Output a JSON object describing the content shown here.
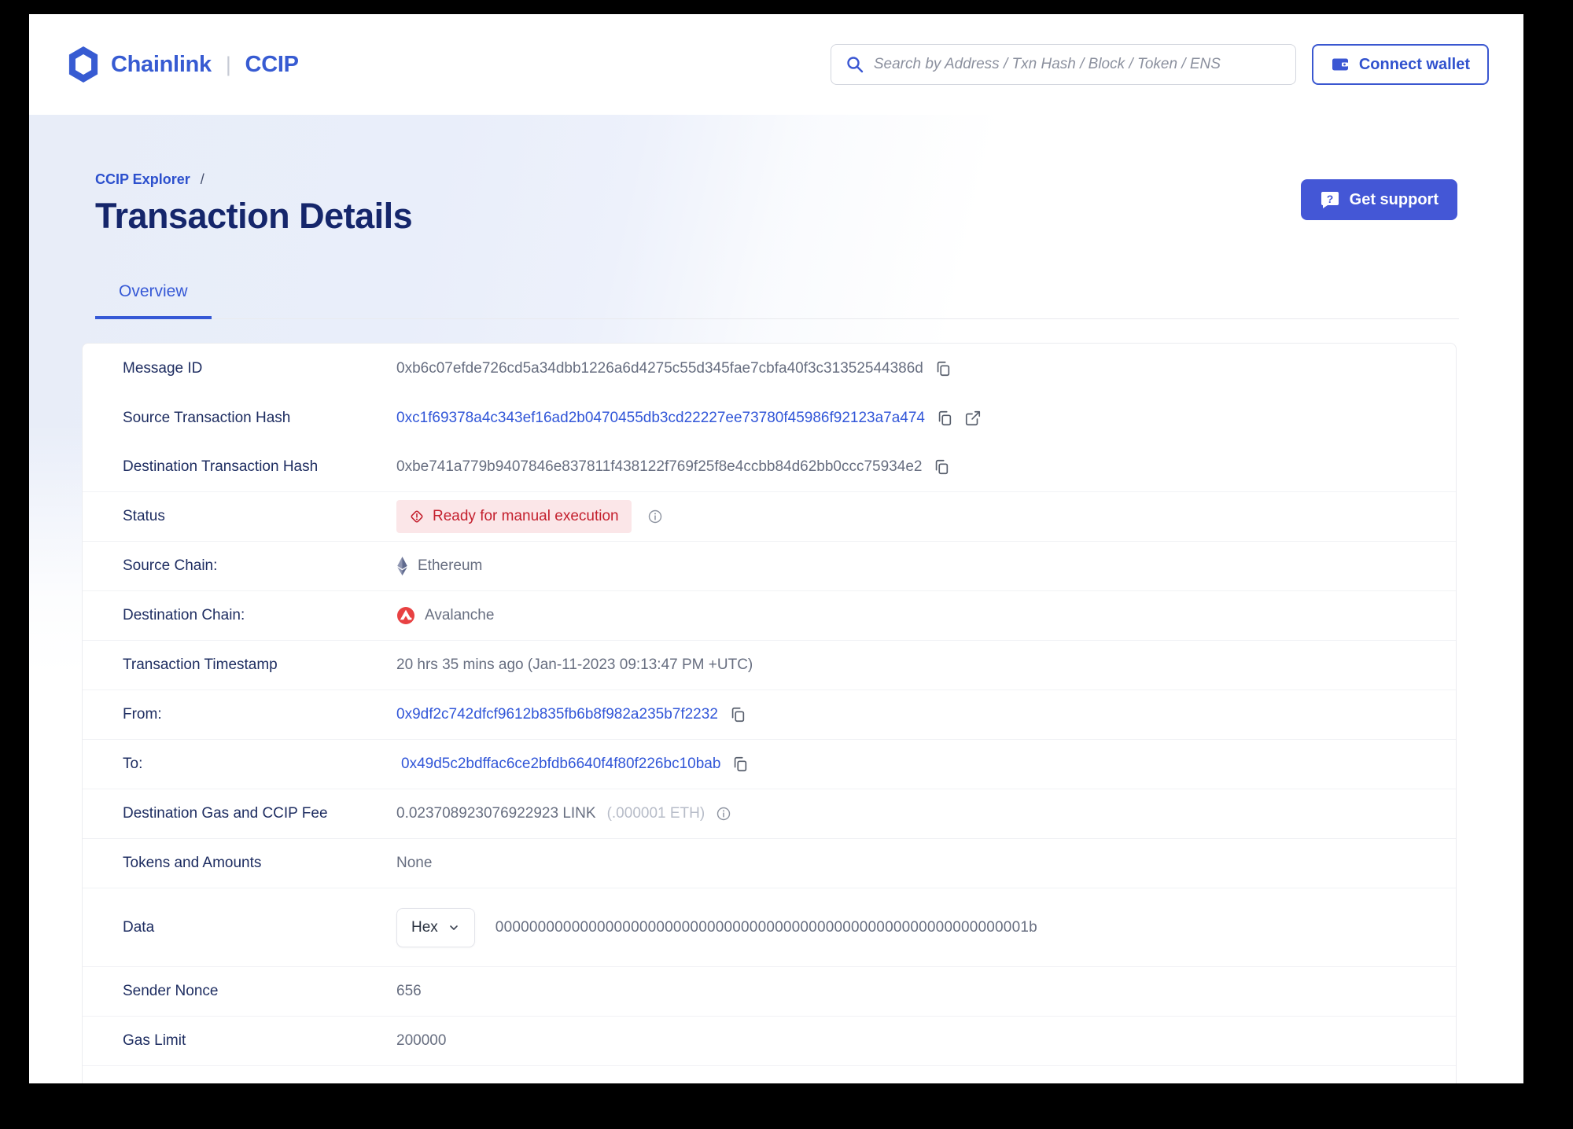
{
  "header": {
    "brand": "Chainlink",
    "brand_divider": "|",
    "product": "CCIP",
    "search_placeholder": "Search by Address / Txn Hash / Block / Token / ENS",
    "connect_wallet_label": "Connect wallet"
  },
  "hero": {
    "breadcrumb": "CCIP Explorer",
    "breadcrumb_separator": "/",
    "title": "Transaction Details",
    "get_support_label": "Get support"
  },
  "tabs": {
    "overview_label": "Overview"
  },
  "details": {
    "message_id": {
      "label": "Message ID",
      "value": "0xb6c07efde726cd5a34dbb1226a6d4275c55d345fae7cbfa40f3c31352544386d"
    },
    "source_tx": {
      "label": "Source Transaction Hash",
      "value": "0xc1f69378a4c343ef16ad2b0470455db3cd22227ee73780f45986f92123a7a474"
    },
    "dest_tx": {
      "label": "Destination Transaction Hash",
      "value": "0xbe741a779b9407846e837811f438122f769f25f8e4ccbb84d62bb0ccc75934e2"
    },
    "status": {
      "label": "Status",
      "value": "Ready for manual execution"
    },
    "source_chain": {
      "label": "Source Chain:",
      "value": "Ethereum"
    },
    "dest_chain": {
      "label": "Destination Chain:",
      "value": "Avalanche"
    },
    "timestamp": {
      "label": "Transaction Timestamp",
      "value": "20 hrs 35 mins ago (Jan-11-2023 09:13:47 PM +UTC)"
    },
    "from": {
      "label": "From:",
      "value": "0x9df2c742dfcf9612b835fb6b8f982a235b7f2232"
    },
    "to": {
      "label": "To:",
      "value": "0x49d5c2bdffac6ce2bfdb6640f4f80f226bc10bab"
    },
    "fee": {
      "label": "Destination Gas and CCIP Fee",
      "value": "0.023708923076922923 LINK",
      "secondary": "(.000001 ETH)"
    },
    "tokens": {
      "label": "Tokens and Amounts",
      "value": "None"
    },
    "data": {
      "label": "Data",
      "format_selected": "Hex",
      "value": "000000000000000000000000000000000000000000000000000000000000001b"
    },
    "sender_nonce": {
      "label": "Sender Nonce",
      "value": "656"
    },
    "gas_limit": {
      "label": "Gas Limit",
      "value": "200000"
    }
  },
  "icons": {
    "chainlink_logo": "hexagon",
    "search": "magnifier",
    "wallet": "wallet",
    "support": "chat-bubble-question",
    "copy": "copy-sheets",
    "external": "external-link",
    "info": "info-circle",
    "status_alert": "alert-diamond",
    "source_chain": "ethereum-diamond",
    "dest_chain": "avalanche-circle",
    "dropdown": "chevron-down"
  },
  "colors": {
    "accent_blue": "#375bd2",
    "link_blue": "#3156d8",
    "title_navy": "#15266b",
    "label_navy": "#1e2d61",
    "value_gray": "#676e80",
    "status_red": "#c4202e",
    "status_bg": "#fbe6e8",
    "support_btn_bg": "#4457d6",
    "avalanche_red": "#e84142",
    "hero_tint": "#e9eefa"
  }
}
